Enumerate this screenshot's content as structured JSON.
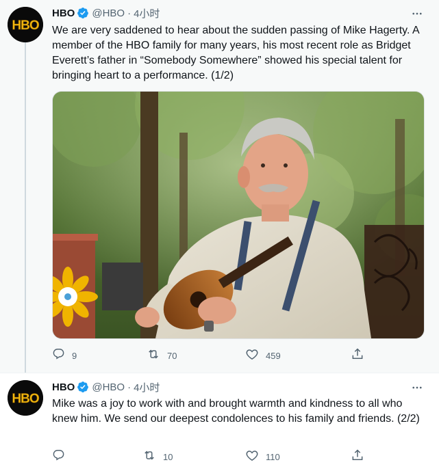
{
  "tweets": [
    {
      "name": "HBO",
      "handle": "@HBO",
      "separator": "·",
      "time": "4小时",
      "text": "We are very saddened to hear about the sudden passing of Mike Hagerty. A member of the HBO family for many years, his most recent role as Bridget Everett’s father in “Somebody Somewhere” showed his special talent for bringing heart to a performance. (1/2)",
      "replies": "9",
      "retweets": "70",
      "likes": "459"
    },
    {
      "name": "HBO",
      "handle": "@HBO",
      "separator": "·",
      "time": "4小时",
      "text": "Mike was a joy to work with and brought warmth and kindness to all who knew him. We send our deepest condolences to his family and friends. (2/2)",
      "replies": "",
      "retweets": "10",
      "likes": "110"
    }
  ],
  "avatar_logo": "HBO",
  "colors": {
    "accent": "#1d9bf0",
    "muted": "#536471",
    "thread_bg": "#f7f9f9",
    "logo_yellow": "#f2b90f"
  },
  "icons": [
    "more-icon",
    "verified-icon",
    "reply-icon",
    "retweet-icon",
    "like-icon",
    "share-icon"
  ]
}
